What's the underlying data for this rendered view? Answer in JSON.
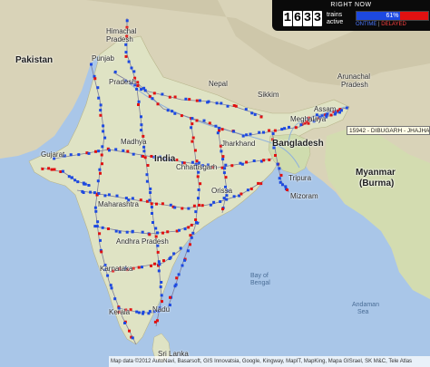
{
  "status_panel": {
    "title": "RIGHT NOW",
    "train_count_digits": [
      "1",
      "6",
      "3",
      "3"
    ],
    "trains_label_line1": "trains",
    "trains_label_line2": "active",
    "ontime_percent_text": "61%",
    "ontime_fraction": 0.61,
    "legend_ontime": "ONTIME",
    "legend_separator": "|",
    "legend_delayed": "DELAYED",
    "colors": {
      "ontime": "#1d49e0",
      "delayed": "#e11111"
    }
  },
  "train_tooltip": "15942 - DIBUGARH - JHAJHA",
  "map_labels": {
    "pakistan": "Pakistan",
    "india": "India",
    "nepal": "Nepal",
    "bangladesh": "Bangladesh",
    "myanmar_1": "Myanmar",
    "myanmar_2": "(Burma)",
    "tripura": "Tripura",
    "mizoram": "Mizoram",
    "sikkim": "Sikkim",
    "meghalaya": "Meghalaya",
    "assam": "Assam",
    "arunachal_1": "Arunachal",
    "arunachal_2": "Pradesh",
    "himachal_1": "Himachal",
    "himachal_2": "Pradesh",
    "punjab": "Punjab",
    "jharkhand": "Jharkhand",
    "chhattisgarh": "Chhattisgarh",
    "orissa": "Orissa",
    "madhya": "Madhya",
    "gujarat": "Gujarat",
    "maharashtra": "Maharashtra",
    "andhra": "Andhra Pradesh",
    "karnataka": "Karnataka",
    "kerala": "Kerala",
    "nadu": "Nadu",
    "bay_1": "Bay of",
    "bay_2": "Bengal",
    "andaman_1": "Andaman",
    "andaman_2": "Sea",
    "srilanka": "Sri Lanka",
    "pradesh_up": "Pradesh"
  },
  "map_attribution": "Map data ©2012 AutoNavi, Basarsoft, GIS Innovatsia, Google, Kingway, MapIT, MapKing, Mapa GISrael, SK M&C, Tele Atlas"
}
